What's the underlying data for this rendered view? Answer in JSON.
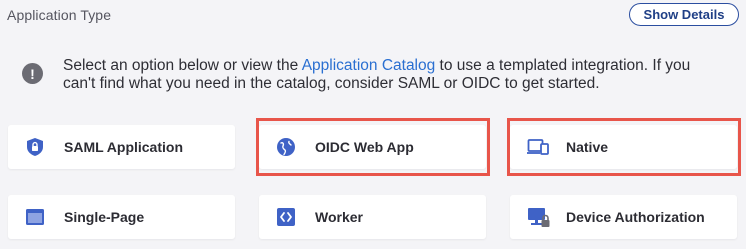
{
  "header": {
    "title": "Application Type",
    "show_details_label": "Show Details"
  },
  "info": {
    "icon": "exclamation-circle-icon",
    "text_before": "Select an option below or view the ",
    "link_text": "Application Catalog",
    "text_after": " to use a templated integration. If you can't find what you need in the catalog, consider SAML or OIDC to get started."
  },
  "app_types": [
    {
      "label": "SAML Application",
      "icon": "shield-lock-icon"
    },
    {
      "label": "OIDC Web App",
      "icon": "globe-icon"
    },
    {
      "label": "Native",
      "icon": "devices-icon"
    },
    {
      "label": "Single-Page",
      "icon": "browser-window-icon"
    },
    {
      "label": "Worker",
      "icon": "code-icon"
    },
    {
      "label": "Device Authorization",
      "icon": "computer-lock-icon"
    }
  ],
  "colors": {
    "accent": "#2b4ea0",
    "link": "#2a6fd1",
    "highlight": "#e8554a",
    "icon": "#3f62c6"
  }
}
